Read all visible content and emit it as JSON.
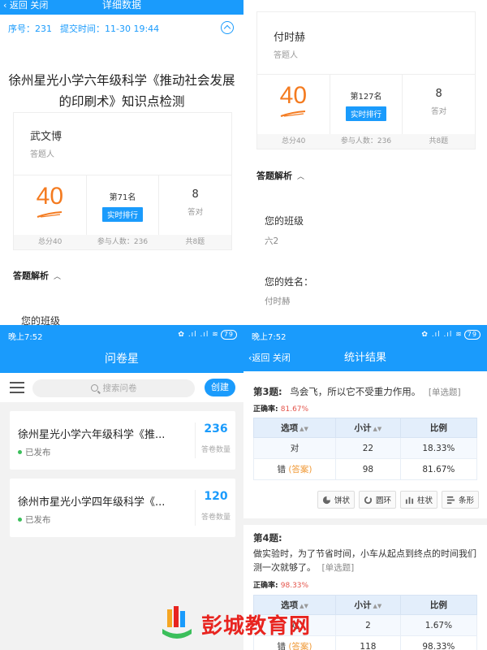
{
  "panelA": {
    "nav": {
      "back": "返回 关闭",
      "title": "详细数据"
    },
    "meta": {
      "serial": "序号：231",
      "submit_time": "提交时间：11-30 19:44"
    },
    "title": "徐州星光小学六年级科学《推动社会发展的印刷术》知识点检测",
    "card": {
      "name": "武文博",
      "role": "答题人",
      "score": "40",
      "rank": "第71名",
      "rank_button": "实时排行",
      "correct": "8",
      "correct_label": "答对",
      "total_score": "总分40",
      "participants": "参与人数：236",
      "total_questions": "共8题"
    },
    "analysis_head": "答题解析",
    "q1_label": "您的班级"
  },
  "panelB": {
    "card": {
      "name": "付时赫",
      "role": "答题人",
      "score": "40",
      "rank": "第127名",
      "rank_button": "实时排行",
      "correct": "8",
      "correct_label": "答对",
      "total_score": "总分40",
      "participants": "参与人数：236",
      "total_questions": "共8题"
    },
    "analysis_head": "答题解析",
    "q1_label": "您的班级",
    "q1_answer": "六2",
    "q2_label": "您的姓名：",
    "q2_answer": "付时赫"
  },
  "panelC": {
    "status": {
      "time": "晚上7:52",
      "right": "✿ .ıl .ıl ≋",
      "battery": "79"
    },
    "app_title": "问卷星",
    "search_placeholder": "搜索问卷",
    "create": "创建",
    "surveys": [
      {
        "title": "徐州星光小学六年级科学《推...",
        "status": "已发布",
        "count": "236",
        "count_label": "答卷数量"
      },
      {
        "title": "徐州市星光小学四年级科学《...",
        "status": "已发布",
        "count": "120",
        "count_label": "答卷数量"
      }
    ]
  },
  "panelD": {
    "status": {
      "time": "晚上7:52",
      "right": "✿ .ıl .ıl ≋",
      "battery": "79"
    },
    "nav": {
      "back": "返回 关闭",
      "title": "统计结果"
    },
    "q3": {
      "num": "第3题:",
      "text": "鸟会飞，所以它不受重力作用。",
      "kind": "[单选题]",
      "acc_label": "正确率:",
      "acc_value": "81.67%",
      "headers": [
        "选项",
        "小计",
        "比例"
      ],
      "rows": [
        {
          "option": "对",
          "tag": "",
          "count": "22",
          "ratio": "18.33%"
        },
        {
          "option": "错",
          "tag": "(答案)",
          "count": "98",
          "ratio": "81.67%"
        }
      ]
    },
    "chart_buttons": [
      "饼状",
      "圆环",
      "柱状",
      "条形"
    ],
    "q4": {
      "num": "第4题:",
      "text": "做实验时，为了节省时间，小车从起点到终点的时间我们测一次就够了。",
      "kind": "[单选题]",
      "acc_label": "正确率:",
      "acc_value": "98.33%",
      "headers": [
        "选项",
        "小计",
        "比例"
      ],
      "rows": [
        {
          "option": "对",
          "tag": "",
          "count": "2",
          "ratio": "1.67%"
        },
        {
          "option": "错",
          "tag": "(答案)",
          "count": "118",
          "ratio": "98.33%"
        }
      ]
    }
  },
  "watermark": {
    "text": "彭城教育网"
  },
  "colors": {
    "primary": "#1a9bfc",
    "score": "#f47b20",
    "accuracy": "#e4544b",
    "answer_tag": "#f09a38",
    "watermark": "#e8241f"
  }
}
